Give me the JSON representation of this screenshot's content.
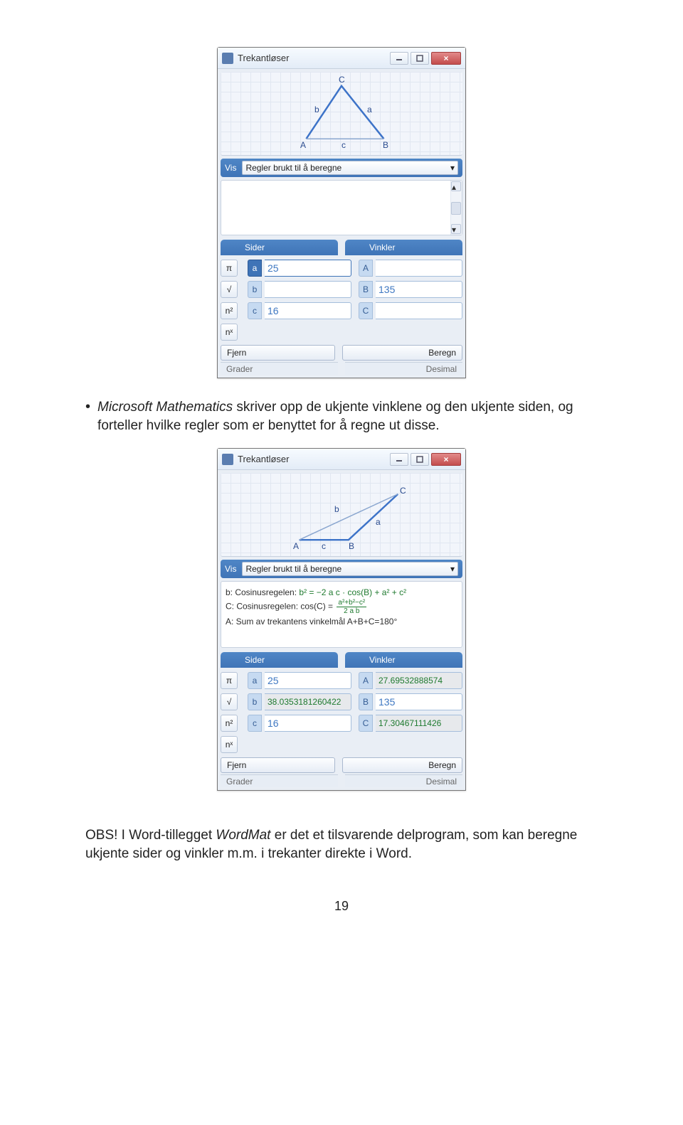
{
  "doc": {
    "bullet_lead_italic": "Microsoft Mathematics",
    "bullet_rest": " skriver opp de ukjente vinklene og den ukjente siden, og forteller hvilke regler som er benyttet for å regne ut disse.",
    "note_lead": "OBS! I Word-tillegget ",
    "note_italic": "WordMat",
    "note_rest": " er det et tilsvarende delprogram, som kan beregne ukjente sider og vinkler m.m. i trekanter direkte i Word.",
    "page_number": "19"
  },
  "shot1": {
    "title": "Trekantløser",
    "vis_label": "Vis",
    "vis_selected": "Regler brukt til å beregne",
    "tri": {
      "A": "A",
      "B": "B",
      "C": "C",
      "a": "a",
      "b": "b",
      "c": "c"
    },
    "tabs": {
      "sider": "Sider",
      "vinkler": "Vinkler"
    },
    "symbols": [
      "π",
      "√",
      "n²",
      "nˣ"
    ],
    "sides": {
      "a": "25",
      "b": "",
      "c": "16"
    },
    "angles": {
      "A": "",
      "B": "135",
      "C": ""
    },
    "btn_clear": "Fjern",
    "btn_calc": "Beregn",
    "status_left": "Grader",
    "status_right": "Desimal"
  },
  "shot2": {
    "title": "Trekantløser",
    "vis_label": "Vis",
    "vis_selected": "Regler brukt til å beregne",
    "tri": {
      "A": "A",
      "B": "B",
      "C": "C",
      "a": "a",
      "b": "b",
      "c": "c"
    },
    "rules": {
      "r1_pre": "b: Cosinusregelen: ",
      "r1_formula": "b² = −2 a c · cos(B) + a² + c²",
      "r2_pre": "C: Cosinusregelen: cos(C) = ",
      "r2_num": "a²+b²−c²",
      "r2_den": "2 a b",
      "r3": "A: Sum av trekantens vinkelmål A+B+C=180°"
    },
    "tabs": {
      "sider": "Sider",
      "vinkler": "Vinkler"
    },
    "symbols": [
      "π",
      "√",
      "n²",
      "nˣ"
    ],
    "sides": {
      "a": "25",
      "b": "38.0353181260422",
      "c": "16"
    },
    "angles": {
      "A": "27.69532888574",
      "B": "135",
      "C": "17.30467111426"
    },
    "btn_clear": "Fjern",
    "btn_calc": "Beregn",
    "status_left": "Grader",
    "status_right": "Desimal"
  }
}
